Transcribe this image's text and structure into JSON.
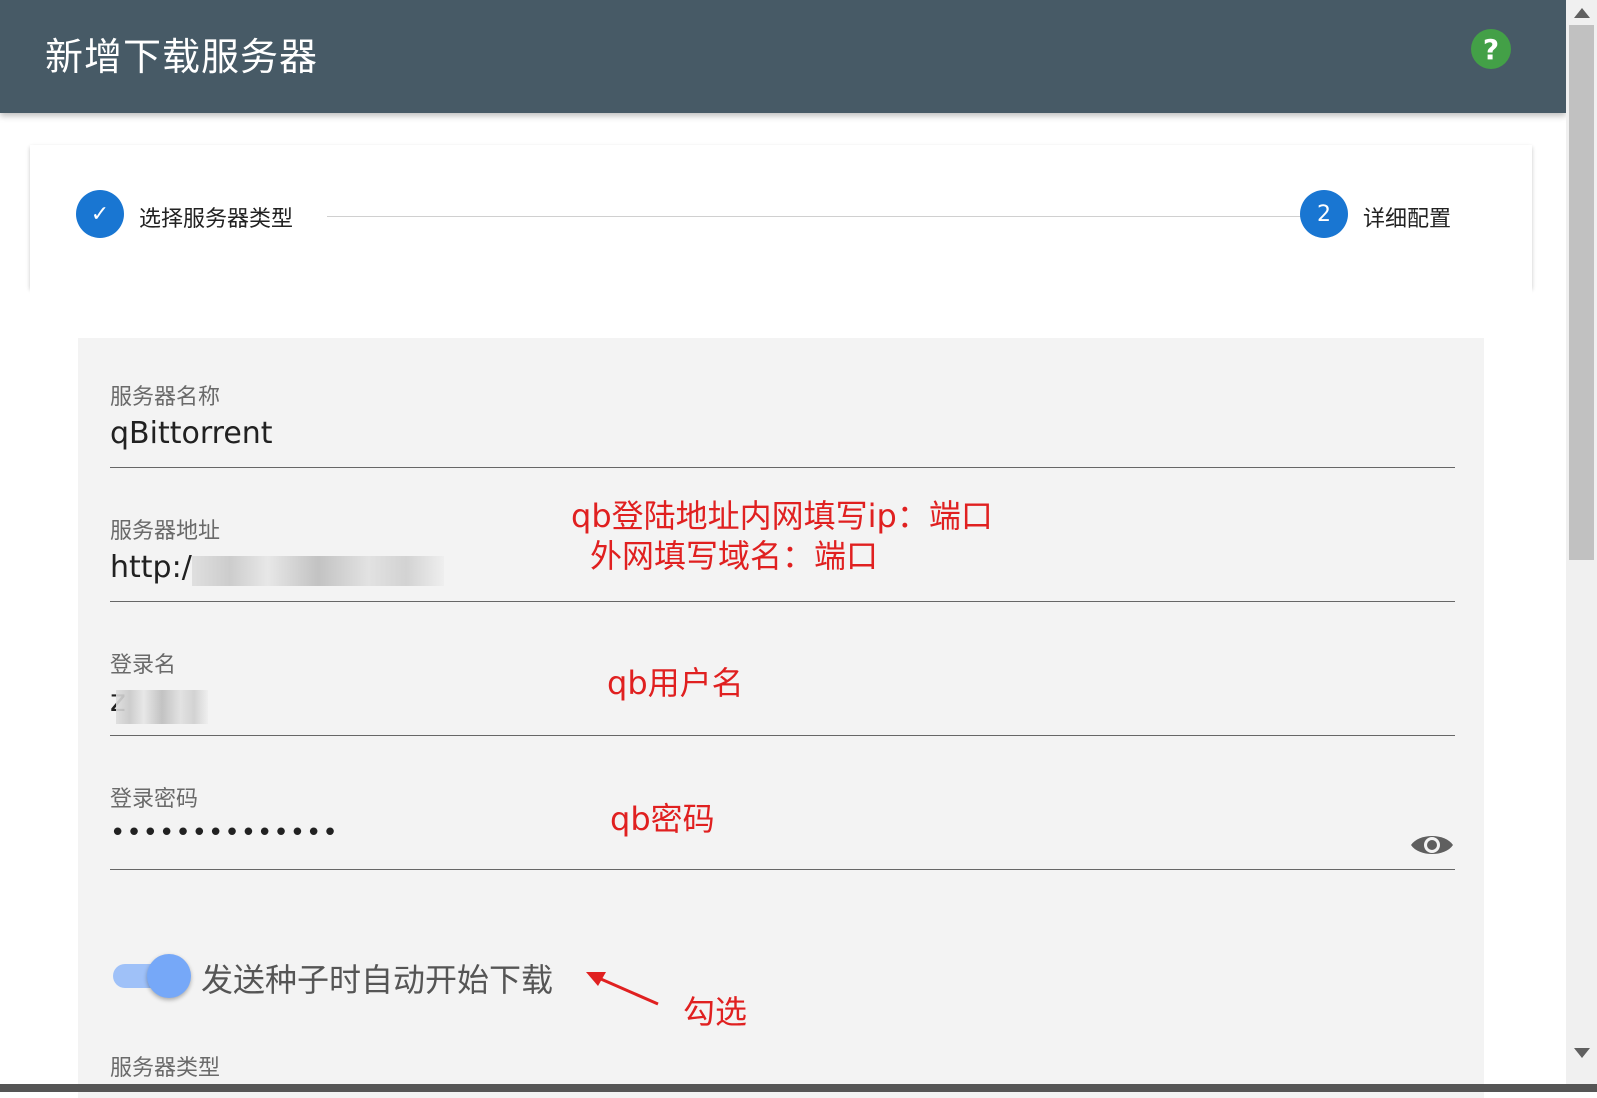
{
  "header": {
    "title": "新增下载服务器",
    "help_symbol": "?"
  },
  "stepper": {
    "steps": [
      {
        "label": "选择服务器类型",
        "state": "completed",
        "marker": "✓"
      },
      {
        "label": "详细配置",
        "state": "active",
        "marker": "2"
      }
    ]
  },
  "form": {
    "name": {
      "label": "服务器名称",
      "value": "qBittorrent"
    },
    "address": {
      "label": "服务器地址",
      "value_visible": "http:/"
    },
    "login": {
      "label": "登录名",
      "value_visible": "z"
    },
    "password": {
      "label": "登录密码",
      "value": "••••••••••••••"
    },
    "autostart": {
      "label": "发送种子时自动开始下载",
      "checked": true
    },
    "server_type": {
      "label": "服务器类型"
    }
  },
  "annotations": {
    "address_line1": "qb登陆地址内网填写ip：端口",
    "address_line2": "外网填写域名：端口",
    "username": "qb用户名",
    "password": "qb密码",
    "toggle": "勾选"
  },
  "colors": {
    "header_bg": "#475a66",
    "accent": "#1976d2",
    "help": "#43a047",
    "annotation": "#e02020",
    "toggle_on": "#76a8f8"
  }
}
